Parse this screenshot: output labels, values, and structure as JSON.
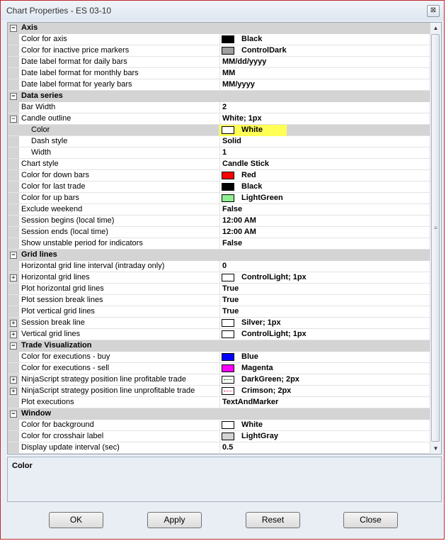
{
  "window": {
    "title": "Chart Properties - ES 03-10",
    "close_label": "⊠"
  },
  "rows": [
    {
      "kind": "cat",
      "label": "Axis",
      "expander": "⊟"
    },
    {
      "kind": "prop",
      "label": "Color for axis",
      "value": "Black",
      "swatch": "#000000"
    },
    {
      "kind": "prop",
      "label": "Color for inactive price markers",
      "value": "ControlDark",
      "swatch": "#a0a0a0"
    },
    {
      "kind": "prop",
      "label": "Date label format for daily bars",
      "value": "MM/dd/yyyy"
    },
    {
      "kind": "prop",
      "label": "Date label format for monthly bars",
      "value": "MM"
    },
    {
      "kind": "prop",
      "label": "Date label format for yearly bars",
      "value": "MM/yyyy"
    },
    {
      "kind": "cat",
      "label": "Data series",
      "expander": "⊟"
    },
    {
      "kind": "prop",
      "label": "Bar Width",
      "value": "2"
    },
    {
      "kind": "prop",
      "label": "Candle outline",
      "value": "White; 1px",
      "expander": "⊟"
    },
    {
      "kind": "sub",
      "label": "Color",
      "value": "White",
      "swatch": "#ffffff",
      "selected": true,
      "highlight": true
    },
    {
      "kind": "sub",
      "label": "Dash style",
      "value": "Solid"
    },
    {
      "kind": "sub",
      "label": "Width",
      "value": "1"
    },
    {
      "kind": "prop",
      "label": "Chart style",
      "value": "Candle Stick"
    },
    {
      "kind": "prop",
      "label": "Color for down bars",
      "value": "Red",
      "swatch": "#ff0000"
    },
    {
      "kind": "prop",
      "label": "Color for last trade",
      "value": "Black",
      "swatch": "#000000"
    },
    {
      "kind": "prop",
      "label": "Color for up bars",
      "value": "LightGreen",
      "swatch": "#90ee90"
    },
    {
      "kind": "prop",
      "label": "Exclude weekend",
      "value": "False"
    },
    {
      "kind": "prop",
      "label": "Session begins (local time)",
      "value": "12:00 AM"
    },
    {
      "kind": "prop",
      "label": "Session ends (local time)",
      "value": "12:00 AM"
    },
    {
      "kind": "prop",
      "label": "Show unstable period for indicators",
      "value": "False"
    },
    {
      "kind": "cat",
      "label": "Grid lines",
      "expander": "⊟"
    },
    {
      "kind": "prop",
      "label": "Horizontal grid line interval (intraday only)",
      "value": "0"
    },
    {
      "kind": "prop",
      "label": "Horizontal grid lines",
      "value": "ControlLight; 1px",
      "swatch": "#ffffff",
      "expander": "⊞"
    },
    {
      "kind": "prop",
      "label": "Plot horizontal grid lines",
      "value": "True"
    },
    {
      "kind": "prop",
      "label": "Plot session break lines",
      "value": "True"
    },
    {
      "kind": "prop",
      "label": "Plot vertical grid lines",
      "value": "True"
    },
    {
      "kind": "prop",
      "label": "Session break line",
      "value": "Silver; 1px",
      "swatch": "#ffffff",
      "expander": "⊞"
    },
    {
      "kind": "prop",
      "label": "Vertical grid lines",
      "value": "ControlLight; 1px",
      "swatch": "#ffffff",
      "expander": "⊞"
    },
    {
      "kind": "cat",
      "label": "Trade Visualization",
      "expander": "⊟"
    },
    {
      "kind": "prop",
      "label": "Color for executions - buy",
      "value": "Blue",
      "swatch": "#0000ff"
    },
    {
      "kind": "prop",
      "label": "Color for executions - sell",
      "value": "Magenta",
      "swatch": "#ff00ff"
    },
    {
      "kind": "prop",
      "label": "NinjaScript strategy position line profitable trade",
      "value": "DarkGreen; 2px",
      "swatch": "#ffffff",
      "dotted": "#006400",
      "expander": "⊞"
    },
    {
      "kind": "prop",
      "label": "NinjaScript strategy position line unprofitable trade",
      "value": "Crimson; 2px",
      "swatch": "#ffffff",
      "dotted": "#dc143c",
      "expander": "⊞"
    },
    {
      "kind": "prop",
      "label": "Plot executions",
      "value": "TextAndMarker"
    },
    {
      "kind": "cat",
      "label": "Window",
      "expander": "⊟"
    },
    {
      "kind": "prop",
      "label": "Color for background",
      "value": "White",
      "swatch": "#ffffff"
    },
    {
      "kind": "prop",
      "label": "Color for crosshair label",
      "value": "LightGray",
      "swatch": "#d3d3d3"
    },
    {
      "kind": "prop",
      "label": "Display update interval (sec)",
      "value": "0.5"
    }
  ],
  "description": {
    "title": "Color"
  },
  "buttons": {
    "ok": "OK",
    "apply": "Apply",
    "reset": "Reset",
    "close": "Close"
  },
  "icons": {
    "scroll_up": "▲",
    "scroll_down": "▼",
    "scroll_grip": "≡"
  }
}
